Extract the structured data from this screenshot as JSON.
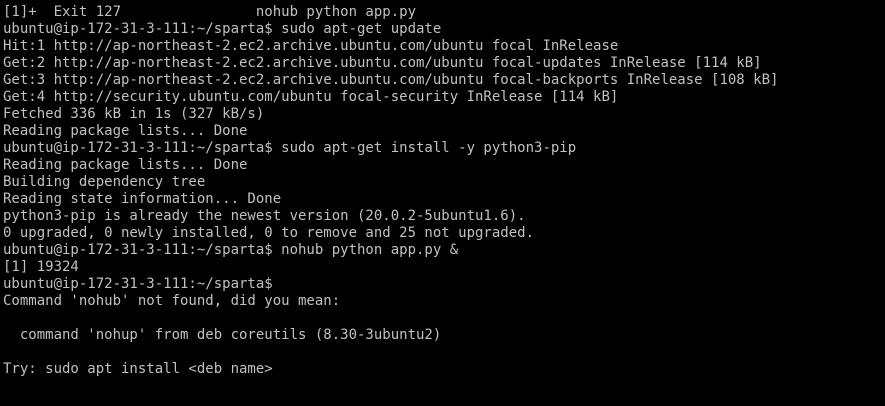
{
  "terminal": {
    "text_color": "#c0c0c0",
    "background_color": "#000000",
    "lines": [
      "[1]+  Exit 127                nohub python app.py",
      "ubuntu@ip-172-31-3-111:~/sparta$ sudo apt-get update",
      "Hit:1 http://ap-northeast-2.ec2.archive.ubuntu.com/ubuntu focal InRelease",
      "Get:2 http://ap-northeast-2.ec2.archive.ubuntu.com/ubuntu focal-updates InRelease [114 kB]",
      "Get:3 http://ap-northeast-2.ec2.archive.ubuntu.com/ubuntu focal-backports InRelease [108 kB]",
      "Get:4 http://security.ubuntu.com/ubuntu focal-security InRelease [114 kB]",
      "Fetched 336 kB in 1s (327 kB/s)",
      "Reading package lists... Done",
      "ubuntu@ip-172-31-3-111:~/sparta$ sudo apt-get install -y python3-pip",
      "Reading package lists... Done",
      "Building dependency tree",
      "Reading state information... Done",
      "python3-pip is already the newest version (20.0.2-5ubuntu1.6).",
      "0 upgraded, 0 newly installed, 0 to remove and 25 not upgraded.",
      "ubuntu@ip-172-31-3-111:~/sparta$ nohub python app.py &",
      "[1] 19324",
      "ubuntu@ip-172-31-3-111:~/sparta$",
      "Command 'nohub' not found, did you mean:",
      "",
      "  command 'nohup' from deb coreutils (8.30-3ubuntu2)",
      "",
      "Try: sudo apt install <deb name>"
    ]
  }
}
